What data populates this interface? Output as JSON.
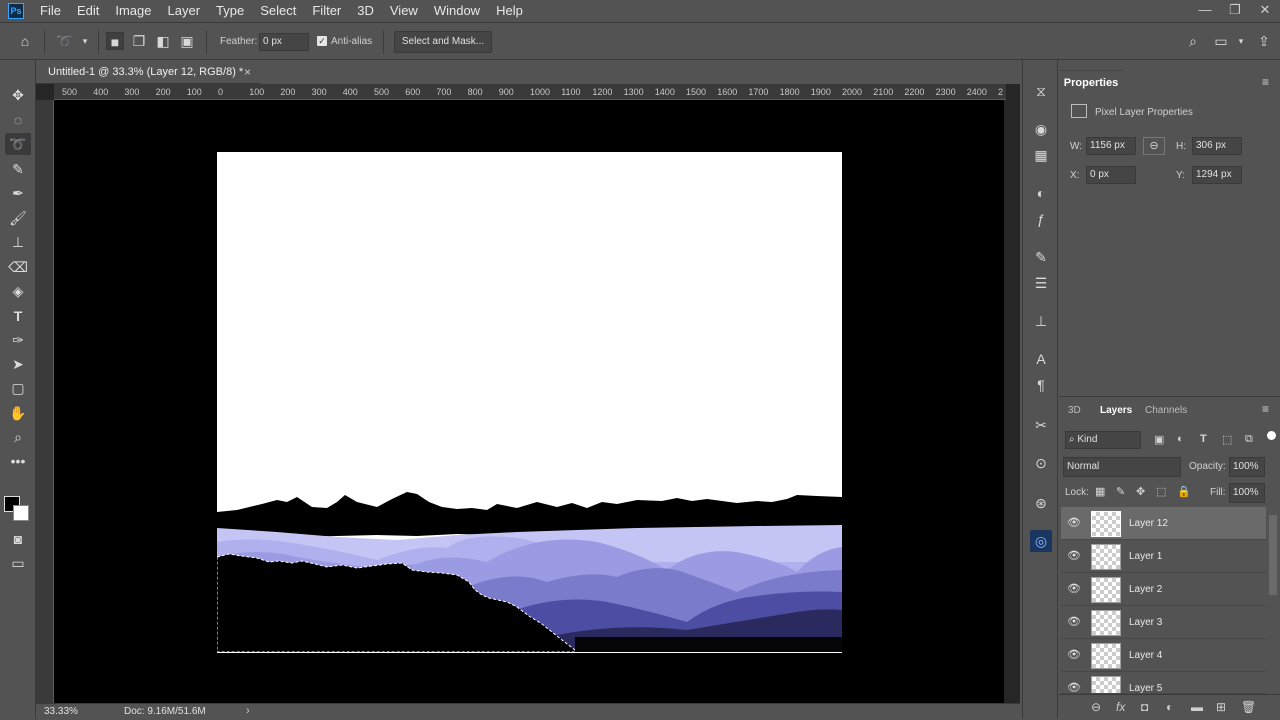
{
  "app": {
    "icon_label": "Ps"
  },
  "menu": [
    "File",
    "Edit",
    "Image",
    "Layer",
    "Type",
    "Select",
    "Filter",
    "3D",
    "View",
    "Window",
    "Help"
  ],
  "window_controls": {
    "minimize": "—",
    "restore": "❐",
    "close": "✕"
  },
  "options": {
    "feather_label": "Feather:",
    "feather_value": "0 px",
    "antialias_label": "Anti-alias",
    "antialias_checked": true,
    "select_mask_label": "Select and Mask..."
  },
  "document": {
    "tab_title": "Untitled-1 @ 33.3% (Layer 12, RGB/8) *",
    "close_glyph": "×"
  },
  "ruler_h": [
    "500",
    "400",
    "300",
    "200",
    "100",
    "0",
    "100",
    "200",
    "300",
    "400",
    "500",
    "600",
    "700",
    "800",
    "900",
    "1000",
    "1100",
    "1200",
    "1300",
    "1400",
    "1500",
    "1600",
    "1700",
    "1800",
    "1900",
    "2000",
    "2100",
    "2200",
    "2300",
    "2400",
    "2"
  ],
  "status": {
    "zoom": "33.33%",
    "doc": "Doc: 9.16M/51.6M",
    "arrow": "›"
  },
  "properties": {
    "title": "Properties",
    "section": "Pixel Layer Properties",
    "w_label": "W:",
    "w_value": "1156 px",
    "h_label": "H:",
    "h_value": "306 px",
    "x_label": "X:",
    "x_value": "0 px",
    "y_label": "Y:",
    "y_value": "1294 px"
  },
  "layers_panel": {
    "tabs": [
      "3D",
      "Layers",
      "Channels"
    ],
    "active_tab": "Layers",
    "filter_kind": "Kind",
    "blend_mode": "Normal",
    "opacity_label": "Opacity:",
    "opacity_value": "100%",
    "lock_label": "Lock:",
    "fill_label": "Fill:",
    "fill_value": "100%",
    "layers": [
      "Layer 12",
      "Layer 1",
      "Layer 2",
      "Layer 3",
      "Layer 4",
      "Layer 5"
    ],
    "selected_layer": "Layer 12"
  },
  "colors": {
    "ui_bg": "#535353",
    "canvas_bg": "#000000",
    "mountain_light": "#c5c5f5",
    "mountain_mid": "#9494dc",
    "mountain_dark": "#4d4da3",
    "mountain_darkest": "#2a2a5e"
  }
}
